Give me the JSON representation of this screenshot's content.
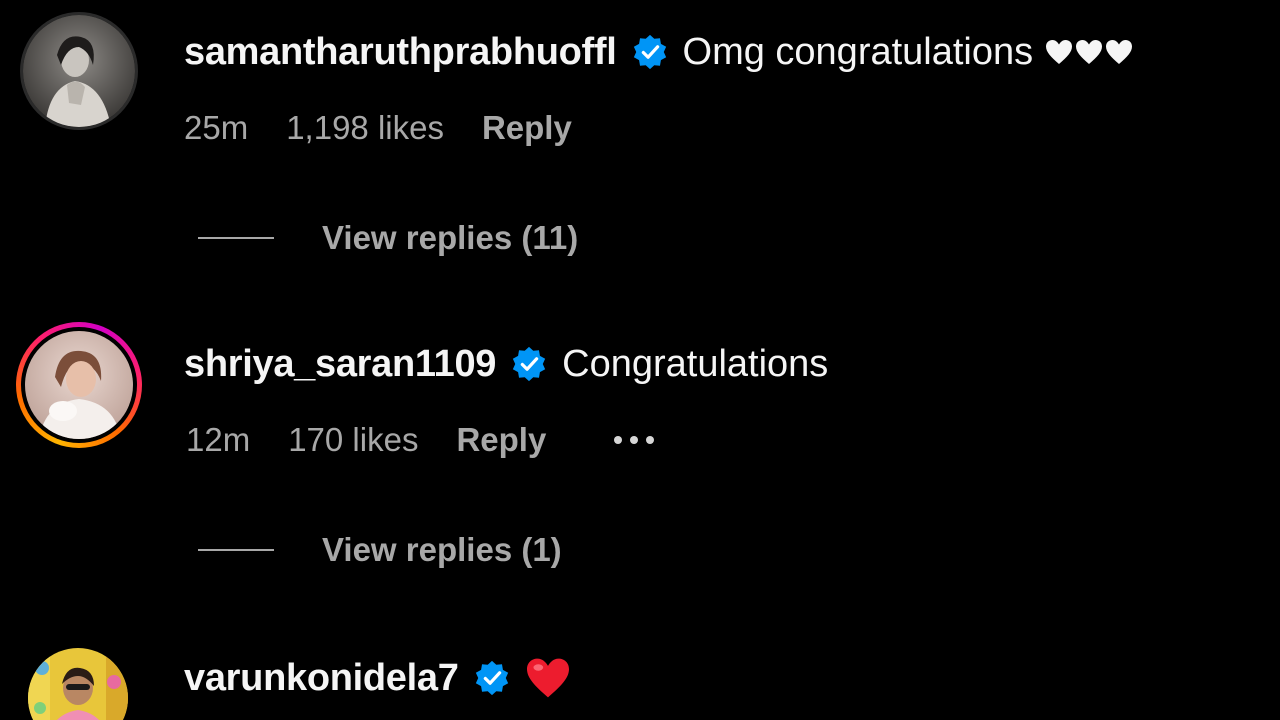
{
  "comments": [
    {
      "username": "samantharuthprabhuoffl",
      "verified": true,
      "text": "Omg congratulations",
      "emoji": "white-heart-x3",
      "time": "25m",
      "likes": "1,198 likes",
      "reply_label": "Reply",
      "view_replies": "View replies (11)",
      "avatar_ring": "none"
    },
    {
      "username": "shriya_saran1109",
      "verified": true,
      "text": "Congratulations",
      "time": "12m",
      "likes": "170 likes",
      "reply_label": "Reply",
      "has_more_menu": true,
      "view_replies": "View replies (1)",
      "avatar_ring": "story-gradient"
    },
    {
      "username": "varunkonidela7",
      "verified": true,
      "emoji": "red-heart",
      "avatar_ring": "none"
    }
  ],
  "colors": {
    "background": "#000000",
    "primary_text": "#f5f5f5",
    "secondary_text": "#a8a8a8",
    "verified_blue": "#0095f6",
    "heart_red": "#ed1c2e",
    "story_ring_start": "#d300c5",
    "story_ring_end": "#ffb400"
  },
  "icons": {
    "verified": "verified-badge-icon",
    "more": "more-options-icon",
    "white_heart": "white-heart-icon",
    "red_heart": "red-heart-icon"
  }
}
